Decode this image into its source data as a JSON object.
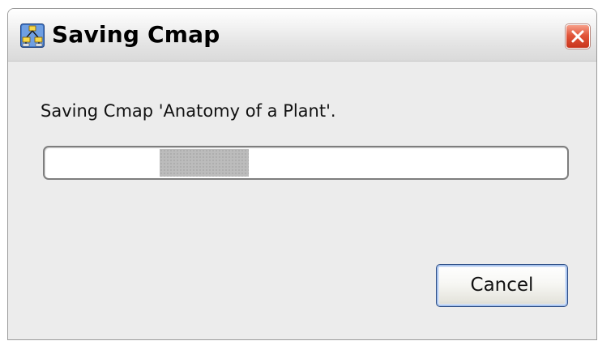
{
  "window": {
    "title": "Saving Cmap",
    "icon": "cmap-app-icon",
    "close_icon": "close-icon"
  },
  "dialog": {
    "message": "Saving Cmap 'Anatomy of a Plant'.",
    "progress": {
      "type": "indeterminate",
      "block_position_fraction": 0.22,
      "block_width_fraction": 0.17
    },
    "cancel_label": "Cancel"
  },
  "colors": {
    "title_text": "#000000",
    "close_button": "#e2553a",
    "progress_block": "#bcbcbc",
    "button_focus": "#a9c4ee"
  }
}
